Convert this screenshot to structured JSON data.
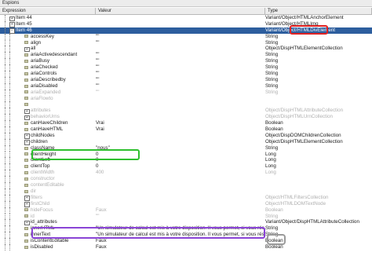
{
  "window": {
    "title": "Espions"
  },
  "columns": {
    "expression": "Expression",
    "value": "Valeur",
    "type": "Type"
  },
  "rows": [
    {
      "indent": 0,
      "node": "plus",
      "expr": "Item 44",
      "val": "",
      "type": "Variant/Object/HTMLAnchorElement",
      "sel": false,
      "fade": false
    },
    {
      "indent": 0,
      "node": "plus",
      "expr": "Item 45",
      "val": "",
      "type": "Variant/Object/HTMLImg",
      "sel": false,
      "fade": false
    },
    {
      "indent": 0,
      "node": "minus",
      "expr": "Item 46",
      "val": "",
      "type": "Variant/Object/HTMLDivElement",
      "sel": true,
      "fade": false
    },
    {
      "indent": 1,
      "node": "prop",
      "expr": "accessKey",
      "val": "\"\"",
      "type": "String",
      "sel": false,
      "fade": false
    },
    {
      "indent": 1,
      "node": "prop",
      "expr": "align",
      "val": "\"\"",
      "type": "String",
      "sel": false,
      "fade": false
    },
    {
      "indent": 1,
      "node": "plus",
      "expr": "all",
      "val": "",
      "type": "Object/DispHTMLElementCollection",
      "sel": false,
      "fade": false
    },
    {
      "indent": 1,
      "node": "prop",
      "expr": "ariaActivedescendant",
      "val": "\"\"",
      "type": "String",
      "sel": false,
      "fade": false
    },
    {
      "indent": 1,
      "node": "prop",
      "expr": "ariaBusy",
      "val": "\"\"",
      "type": "String",
      "sel": false,
      "fade": false
    },
    {
      "indent": 1,
      "node": "prop",
      "expr": "ariaChecked",
      "val": "\"\"",
      "type": "String",
      "sel": false,
      "fade": false
    },
    {
      "indent": 1,
      "node": "prop",
      "expr": "ariaControls",
      "val": "\"\"",
      "type": "String",
      "sel": false,
      "fade": false
    },
    {
      "indent": 1,
      "node": "prop",
      "expr": "ariaDescribedby",
      "val": "\"\"",
      "type": "String",
      "sel": false,
      "fade": false
    },
    {
      "indent": 1,
      "node": "prop",
      "expr": "ariaDisabled",
      "val": "\"\"",
      "type": "String",
      "sel": false,
      "fade": false
    },
    {
      "indent": 1,
      "node": "prop",
      "expr": "ariaExpanded",
      "val": "\"\"",
      "type": "String",
      "sel": false,
      "fade": true
    },
    {
      "indent": 1,
      "node": "prop",
      "expr": "ariaFlowto",
      "val": "",
      "type": "",
      "sel": false,
      "fade": true
    },
    {
      "indent": 1,
      "node": "prop",
      "expr": "",
      "val": "",
      "type": "",
      "sel": false,
      "fade": true
    },
    {
      "indent": 1,
      "node": "plus",
      "expr": "attributes",
      "val": "",
      "type": "Object/DispHTMLAttributeCollection",
      "sel": false,
      "fade": true
    },
    {
      "indent": 1,
      "node": "plus",
      "expr": "behaviorUrns",
      "val": "",
      "type": "Object/DispHTMLUrnCollection",
      "sel": false,
      "fade": true
    },
    {
      "indent": 1,
      "node": "prop",
      "expr": "canHaveChildren",
      "val": "Vrai",
      "type": "Boolean",
      "sel": false,
      "fade": false
    },
    {
      "indent": 1,
      "node": "prop",
      "expr": "canHaveHTML",
      "val": "Vrai",
      "type": "Boolean",
      "sel": false,
      "fade": false
    },
    {
      "indent": 1,
      "node": "plus",
      "expr": "childNodes",
      "val": "",
      "type": "Object/DispDOMChildrenCollection",
      "sel": false,
      "fade": false
    },
    {
      "indent": 1,
      "node": "plus",
      "expr": "children",
      "val": "",
      "type": "Object/DispHTMLElementCollection",
      "sel": false,
      "fade": false
    },
    {
      "indent": 1,
      "node": "prop",
      "expr": "className",
      "val": "\"nous\"",
      "type": "String",
      "sel": false,
      "fade": false
    },
    {
      "indent": 1,
      "node": "prop",
      "expr": "clientHeight",
      "val": "0",
      "type": "Long",
      "sel": false,
      "fade": false
    },
    {
      "indent": 1,
      "node": "prop",
      "expr": "clientLeft",
      "val": "0",
      "type": "Long",
      "sel": false,
      "fade": false
    },
    {
      "indent": 1,
      "node": "prop",
      "expr": "clientTop",
      "val": "0",
      "type": "Long",
      "sel": false,
      "fade": false
    },
    {
      "indent": 1,
      "node": "prop",
      "expr": "clientWidth",
      "val": "400",
      "type": "Long",
      "sel": false,
      "fade": true
    },
    {
      "indent": 1,
      "node": "prop",
      "expr": "constructor",
      "val": "",
      "type": "",
      "sel": false,
      "fade": true
    },
    {
      "indent": 1,
      "node": "prop",
      "expr": "contentEditable",
      "val": "",
      "type": "",
      "sel": false,
      "fade": true
    },
    {
      "indent": 1,
      "node": "prop",
      "expr": "dir",
      "val": "",
      "type": "",
      "sel": false,
      "fade": true
    },
    {
      "indent": 1,
      "node": "plus",
      "expr": "filters",
      "val": "",
      "type": "Object/HTMLFiltersCollection",
      "sel": false,
      "fade": true
    },
    {
      "indent": 1,
      "node": "plus",
      "expr": "firstChild",
      "val": "",
      "type": "Object/HTMLDOMTextNode",
      "sel": false,
      "fade": true
    },
    {
      "indent": 1,
      "node": "prop",
      "expr": "hideFocus",
      "val": "Faux",
      "type": "Boolean",
      "sel": false,
      "fade": true
    },
    {
      "indent": 1,
      "node": "prop",
      "expr": "id",
      "val": "\"\"",
      "type": "String",
      "sel": false,
      "fade": true
    },
    {
      "indent": 1,
      "node": "plus",
      "expr": "id_attributes",
      "val": "",
      "type": "Variant/Object/DispHTMLAttributeCollection",
      "sel": false,
      "fade": false
    },
    {
      "indent": 1,
      "node": "prop",
      "expr": "innerHTML",
      "val": "\"Un simulateur de calcul est mis à votre disposition. Il vous permet, si vous résidez en",
      "type": "String",
      "sel": false,
      "fade": false
    },
    {
      "indent": 1,
      "node": "prop",
      "expr": "innerText",
      "val": "\"Un simulateur de calcul est mis à votre disposition. Il vous permet, si vous résidez en",
      "type": "String",
      "sel": false,
      "fade": false
    },
    {
      "indent": 1,
      "node": "prop",
      "expr": "isContentEditable",
      "val": "Faux",
      "type": "Boolean",
      "sel": false,
      "fade": false
    },
    {
      "indent": 1,
      "node": "prop",
      "expr": "isDisabled",
      "val": "Faux",
      "type": "Boolean",
      "sel": false,
      "fade": false
    }
  ]
}
